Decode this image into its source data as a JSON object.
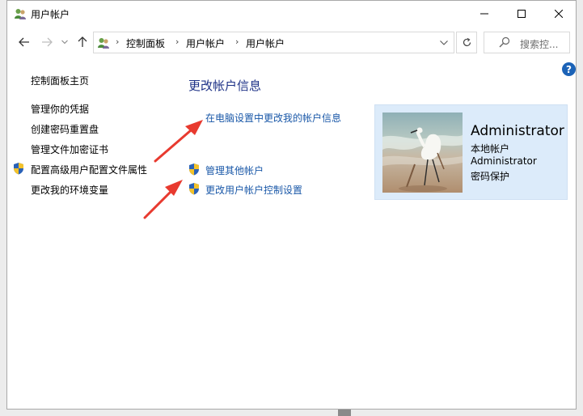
{
  "window": {
    "title": "用户帐户"
  },
  "address": {
    "crumbs": [
      "控制面板",
      "用户帐户",
      "用户帐户"
    ],
    "search_placeholder": "搜索控..."
  },
  "left_pane": {
    "home": "控制面板主页",
    "links": [
      "管理你的凭据",
      "创建密码重置盘",
      "管理文件加密证书",
      "配置高级用户配置文件属性",
      "更改我的环境变量"
    ]
  },
  "main": {
    "heading": "更改帐户信息",
    "tasks": [
      "在电脑设置中更改我的帐户信息",
      "管理其他帐户",
      "更改用户帐户控制设置"
    ]
  },
  "user": {
    "name": "Administrator",
    "type": "本地帐户",
    "account": "Administrator",
    "password": "密码保护"
  },
  "help_glyph": "?",
  "colors": {
    "link": "#1a58a8",
    "heading": "#1e3287",
    "tile": "#dcebfa",
    "annotation_arrow": "#e83a2f"
  }
}
